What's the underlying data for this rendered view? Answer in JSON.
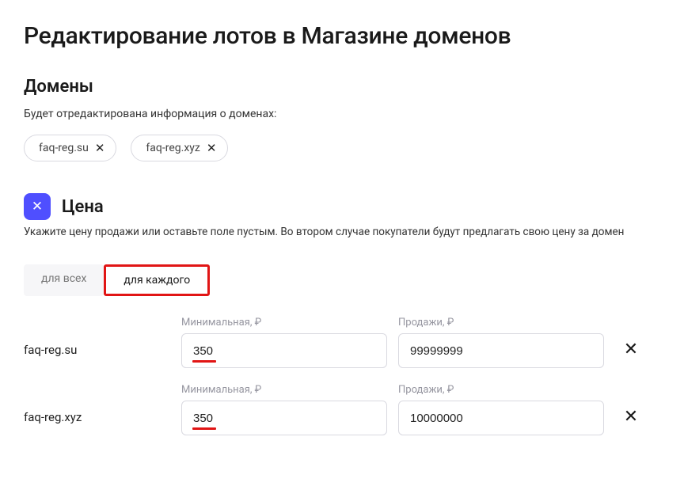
{
  "page_title": "Редактирование лотов в Магазине доменов",
  "domains_section": {
    "title": "Домены",
    "description": "Будет отредактирована информация о доменах:",
    "chips": [
      {
        "label": "faq-reg.su"
      },
      {
        "label": "faq-reg.xyz"
      }
    ]
  },
  "price_section": {
    "title": "Цена",
    "description": "Укажите цену продажи или оставьте поле пустым. Во втором случае покупатели будут предлагать свою цену за домен",
    "tabs": {
      "all": "для всех",
      "each": "для каждого"
    },
    "col_min_label": "Минимальная, ₽",
    "col_sale_label": "Продажи, ₽",
    "rows": [
      {
        "domain": "faq-reg.su",
        "min": "350",
        "sale": "99999999"
      },
      {
        "domain": "faq-reg.xyz",
        "min": "350",
        "sale": "10000000"
      }
    ]
  }
}
